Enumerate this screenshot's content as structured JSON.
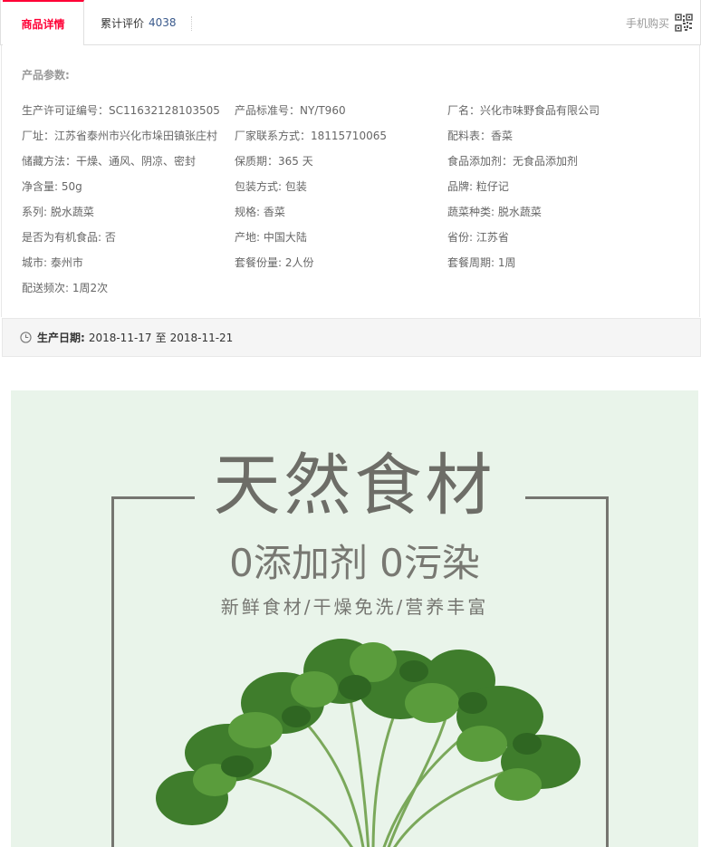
{
  "tabs": {
    "active": "商品详情",
    "review_label": "累计评价",
    "review_count": "4038",
    "mobile_buy": "手机购买"
  },
  "params": {
    "title": "产品参数:",
    "items": [
      "生产许可证编号：SC11632128103505",
      "产品标准号：NY/T960",
      "厂名：兴化市味野食品有限公司",
      "厂址：江苏省泰州市兴化市垛田镇张庄村",
      "厂家联系方式：18115710065",
      "配料表：香菜",
      "储藏方法：干燥、通风、阴凉、密封",
      "保质期：365 天",
      "食品添加剂：无食品添加剂",
      "净含量: 50g",
      "包装方式: 包装",
      "品牌: 粒仔记",
      "系列: 脱水蔬菜",
      "规格: 香菜",
      "蔬菜种类: 脱水蔬菜",
      "是否为有机食品: 否",
      "产地: 中国大陆",
      "省份: 江苏省",
      "城市: 泰州市",
      "套餐份量: 2人份",
      "套餐周期: 1周",
      "配送频次: 1周2次"
    ]
  },
  "production_date": {
    "label": "生产日期:",
    "from": "2018-11-17",
    "sep": "至",
    "to": "2018-11-21"
  },
  "banner": {
    "headline": "天然食材",
    "subline": "0添加剂 0污染",
    "tagline": "新鲜食材/干燥免洗/营养丰富"
  },
  "icons": {
    "qr": "qr-code-icon",
    "clock": "clock-icon",
    "herb": "coriander-image"
  },
  "colors": {
    "accent": "#ff0036",
    "count": "#3a5a8c",
    "banner_bg": "#e9f4ea",
    "banner_text": "#6d6d67"
  }
}
